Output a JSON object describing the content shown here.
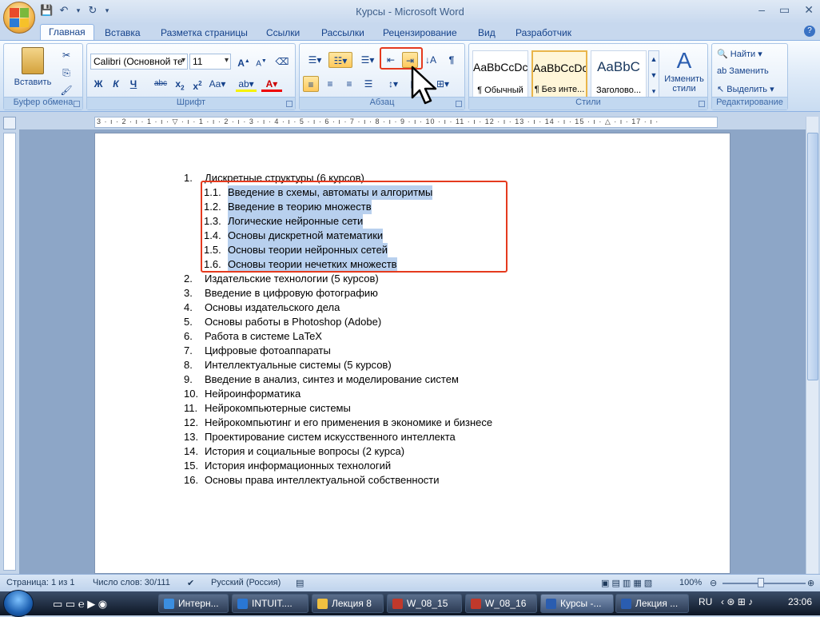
{
  "window": {
    "title": "Курсы - Microsoft Word"
  },
  "tabs": [
    "Главная",
    "Вставка",
    "Разметка страницы",
    "Ссылки",
    "Рассылки",
    "Рецензирование",
    "Вид",
    "Разработчик"
  ],
  "ribbon": {
    "clipboard": {
      "label": "Буфер обмена",
      "paste": "Вставить"
    },
    "font": {
      "label": "Шрифт",
      "name": "Calibri (Основной те",
      "size": "11"
    },
    "paragraph": {
      "label": "Абзац"
    },
    "styles": {
      "label": "Стили",
      "items": [
        {
          "preview": "AaBbCcDc",
          "name": "¶ Обычный"
        },
        {
          "preview": "AaBbCcDc",
          "name": "¶ Без инте..."
        },
        {
          "preview": "AaBbC",
          "name": "Заголово..."
        }
      ],
      "change": "Изменить стили"
    },
    "editing": {
      "label": "Редактирование",
      "find": "Найти",
      "replace": "Заменить",
      "select": "Выделить"
    }
  },
  "ruler": {
    "text": "3 · ı · 2 · ı · 1 · ı · ▽ · ı · 1 · ı · 2 · ı · 3 · ı · 4 · ı · 5 · ı · 6 · ı · 7 · ı · 8 · ı · 9 · ı · 10 · ı · 11 · ı · 12 · ı · 13 · ı · 14 · ı · 15 · ı · △ · ı · 17 · ı ·"
  },
  "document": {
    "items": [
      {
        "num": "1.",
        "text": "Дискретные структуры (6 курсов)",
        "sub": false
      },
      {
        "num": "1.1.",
        "text": "Введение в схемы, автоматы и алгоритмы",
        "sub": true
      },
      {
        "num": "1.2.",
        "text": "Введение в теорию множеств",
        "sub": true
      },
      {
        "num": "1.3.",
        "text": "Логические нейронные сети",
        "sub": true
      },
      {
        "num": "1.4.",
        "text": "Основы дискретной математики",
        "sub": true
      },
      {
        "num": "1.5.",
        "text": "Основы теории нейронных сетей",
        "sub": true
      },
      {
        "num": "1.6.",
        "text": "Основы теории нечетких множеств",
        "sub": true
      },
      {
        "num": "2.",
        "text": "Издательские технологии (5 курсов)",
        "sub": false
      },
      {
        "num": "3.",
        "text": "Введение в цифровую фотографию",
        "sub": false
      },
      {
        "num": "4.",
        "text": "Основы издательского дела",
        "sub": false
      },
      {
        "num": "5.",
        "text": "Основы работы в Photoshop (Adobe)",
        "sub": false
      },
      {
        "num": "6.",
        "text": "Работа в системе LaTeX",
        "sub": false
      },
      {
        "num": "7.",
        "text": "Цифровые фотоаппараты",
        "sub": false
      },
      {
        "num": "8.",
        "text": "Интеллектуальные системы (5 курсов)",
        "sub": false
      },
      {
        "num": "9.",
        "text": "Введение в анализ, синтез и моделирование систем",
        "sub": false
      },
      {
        "num": "10.",
        "text": "Нейроинформатика",
        "sub": false
      },
      {
        "num": "11.",
        "text": "Нейрокомпьютерные системы",
        "sub": false
      },
      {
        "num": "12.",
        "text": "Нейрокомпьютинг и его применения в экономике и бизнесе",
        "sub": false
      },
      {
        "num": "13.",
        "text": "Проектирование систем искусственного интеллекта",
        "sub": false
      },
      {
        "num": "14.",
        "text": "История и социальные вопросы (2 курса)",
        "sub": false
      },
      {
        "num": "15.",
        "text": "История информационных технологий",
        "sub": false
      },
      {
        "num": "16.",
        "text": "Основы права интеллектуальной собственности",
        "sub": false
      }
    ]
  },
  "status": {
    "page": "Страница: 1 из 1",
    "words": "Число слов: 30/111",
    "lang": "Русский (Россия)",
    "zoom": "100%"
  },
  "taskbar": {
    "items": [
      {
        "label": "Интерн...",
        "color": "#3b8ee0"
      },
      {
        "label": "INTUIT....",
        "color": "#2a77d4"
      },
      {
        "label": "Лекция 8",
        "color": "#f0c040"
      },
      {
        "label": "W_08_15",
        "color": "#c0392b"
      },
      {
        "label": "W_08_16",
        "color": "#c0392b"
      },
      {
        "label": "Курсы -...",
        "color": "#2a5db0"
      },
      {
        "label": "Лекция ...",
        "color": "#2a5db0"
      }
    ],
    "lang": "RU",
    "time": "23:06"
  }
}
